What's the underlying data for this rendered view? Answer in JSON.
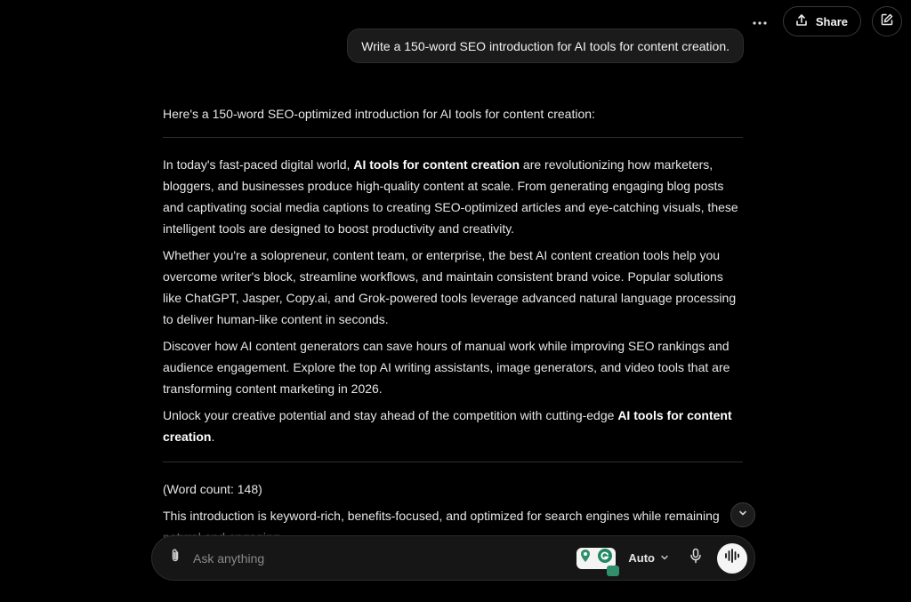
{
  "header": {
    "share_label": "Share",
    "icons": [
      "more-icon",
      "share-icon",
      "edit-icon"
    ]
  },
  "conversation": {
    "user_message": "Write a 150-word SEO introduction for AI tools for content creation.",
    "response": {
      "intro": "Here's a 150-word SEO-optimized introduction for AI tools for content creation:",
      "p1_a": "In today's fast-paced digital world, ",
      "p1_b": "AI tools for content creation",
      "p1_c": " are revolutionizing how marketers, bloggers, and businesses produce high-quality content at scale. From generating engaging blog posts and captivating social media captions to creating SEO-optimized articles and eye-catching visuals, these intelligent tools are designed to boost productivity and creativity.",
      "p2": "Whether you're a solopreneur, content team, or enterprise, the best AI content creation tools help you overcome writer's block, streamline workflows, and maintain consistent brand voice. Popular solutions like ChatGPT, Jasper, Copy.ai, and Grok-powered tools leverage advanced natural language processing to deliver human-like content in seconds.",
      "p3": "Discover how AI content generators can save hours of manual work while improving SEO rankings and audience engagement. Explore the top AI writing assistants, image generators, and video tools that are transforming content marketing in 2026.",
      "p4_a": "Unlock your creative potential and stay ahead of the competition with cutting-edge ",
      "p4_b": "AI tools for content creation",
      "p4_c": ".",
      "word_count": "(Word count: 148)",
      "closing": "This introduction is keyword-rich, benefits-focused, and optimized for search engines while remaining natural and engaging."
    }
  },
  "composer": {
    "placeholder": "Ask anything",
    "mode_label": "Auto",
    "icons": [
      "paperclip-icon",
      "chevron-down-icon",
      "mic-icon",
      "voice-wave-icon"
    ]
  },
  "colors": {
    "background": "#000000",
    "text": "#e6e6e6",
    "bubble": "#1b1b1b",
    "border": "#2c2c2c"
  }
}
